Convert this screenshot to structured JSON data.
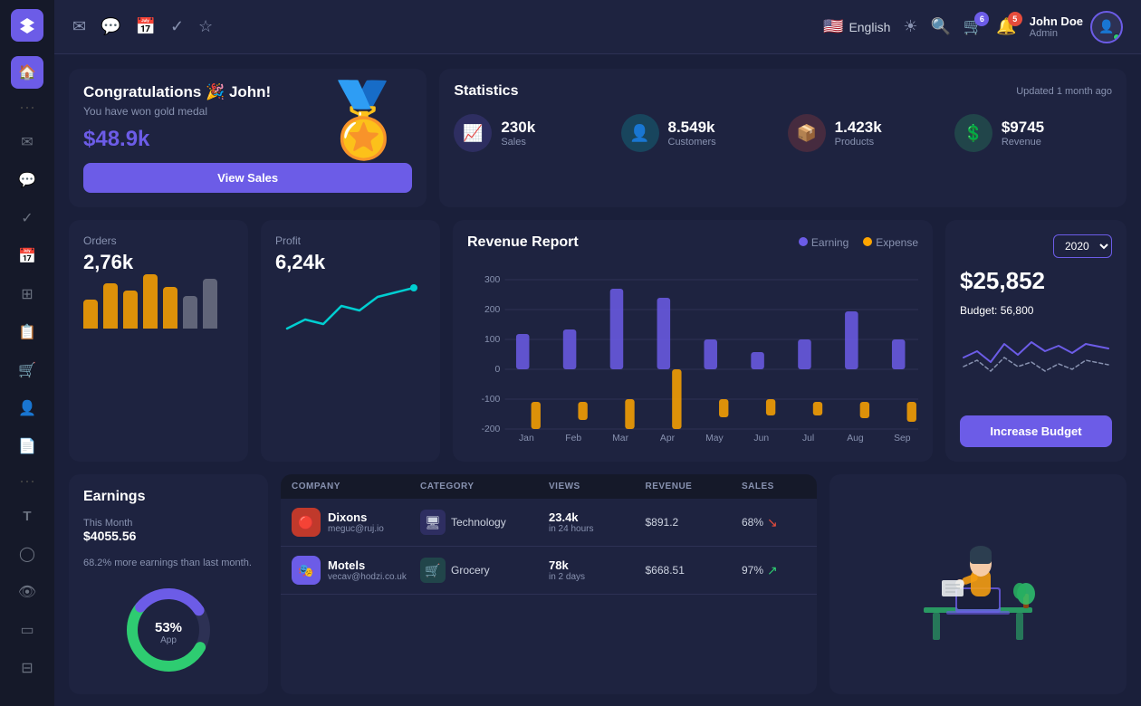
{
  "sidebar": {
    "logo": "▼",
    "items": [
      {
        "icon": "🏠",
        "label": "home",
        "active": true
      },
      {
        "icon": "···",
        "label": "dots1",
        "dots": true
      },
      {
        "icon": "✉",
        "label": "mail"
      },
      {
        "icon": "💬",
        "label": "chat"
      },
      {
        "icon": "✓",
        "label": "check"
      },
      {
        "icon": "📅",
        "label": "calendar"
      },
      {
        "icon": "⊞",
        "label": "grid"
      },
      {
        "icon": "📋",
        "label": "list"
      },
      {
        "icon": "🛒",
        "label": "cart"
      },
      {
        "icon": "👤",
        "label": "user"
      },
      {
        "icon": "📄",
        "label": "doc"
      },
      {
        "icon": "···",
        "label": "dots2",
        "dots": true
      },
      {
        "icon": "T",
        "label": "text"
      },
      {
        "icon": "◯",
        "label": "circle"
      },
      {
        "icon": "👁",
        "label": "eye"
      },
      {
        "icon": "▭",
        "label": "rect"
      },
      {
        "icon": "⊟",
        "label": "minus-rect"
      },
      {
        "icon": "···",
        "label": "dots3",
        "dots": true
      }
    ]
  },
  "topbar": {
    "icons": [
      "✉",
      "💬",
      "📅",
      "✓",
      "☆"
    ],
    "language": "English",
    "flag": "🇺🇸",
    "cart_badge": "6",
    "notif_badge": "5",
    "user_name": "John Doe",
    "user_role": "Admin"
  },
  "congrats": {
    "title": "Congratulations 🎉 John!",
    "subtitle": "You have won gold medal",
    "amount": "$48.9k",
    "button": "View Sales",
    "medal": "🥇"
  },
  "statistics": {
    "title": "Statistics",
    "updated": "Updated 1 month ago",
    "items": [
      {
        "value": "230k",
        "label": "Sales",
        "icon": "📈",
        "color": "purple"
      },
      {
        "value": "8.549k",
        "label": "Customers",
        "icon": "👤",
        "color": "teal"
      },
      {
        "value": "1.423k",
        "label": "Products",
        "icon": "📦",
        "color": "red"
      },
      {
        "value": "$9745",
        "label": "Revenue",
        "icon": "💲",
        "color": "green"
      }
    ]
  },
  "orders": {
    "label": "Orders",
    "value": "2,76k",
    "bars": [
      35,
      55,
      45,
      65,
      50,
      40,
      60
    ]
  },
  "profit": {
    "label": "Profit",
    "value": "6,24k"
  },
  "revenue": {
    "title": "Revenue Report",
    "legend": [
      {
        "label": "Earning",
        "color": "#6c5ce7"
      },
      {
        "label": "Expense",
        "color": "#ffa500"
      }
    ],
    "x_labels": [
      "Jan",
      "Feb",
      "Mar",
      "Apr",
      "May",
      "Jun",
      "Jul",
      "Aug",
      "Sep"
    ],
    "y_labels": [
      "300",
      "200",
      "100",
      "0",
      "-100",
      "-200"
    ]
  },
  "budget": {
    "year": "2020",
    "amount": "$25,852",
    "label": "Budget:",
    "budget_val": "56,800",
    "button": "Increase Budget"
  },
  "earnings": {
    "title": "Earnings",
    "period": "This Month",
    "amount": "$4055.56",
    "note": "68.2% more earnings than last month.",
    "donut_pct": "53%",
    "donut_label": "App"
  },
  "table": {
    "headers": [
      "COMPANY",
      "CATEGORY",
      "VIEWS",
      "REVENUE",
      "SALES"
    ],
    "rows": [
      {
        "company": "Dixons",
        "email": "meguc@ruj.io",
        "logo_bg": "#e74c3c",
        "logo_icon": "🔴",
        "category": "Technology",
        "cat_icon": "🖥",
        "cat_color": "#6c5ce7",
        "views_main": "23.4k",
        "views_sub": "in 24 hours",
        "revenue": "$891.2",
        "sales": "68%",
        "trend": "down"
      },
      {
        "company": "Motels",
        "email": "vecav@hodzi.co.uk",
        "logo_bg": "#6c5ce7",
        "logo_icon": "🎭",
        "category": "Grocery",
        "cat_icon": "🛒",
        "cat_color": "#2ecc71",
        "views_main": "78k",
        "views_sub": "in 2 days",
        "revenue": "$668.51",
        "sales": "97%",
        "trend": "up"
      }
    ]
  }
}
